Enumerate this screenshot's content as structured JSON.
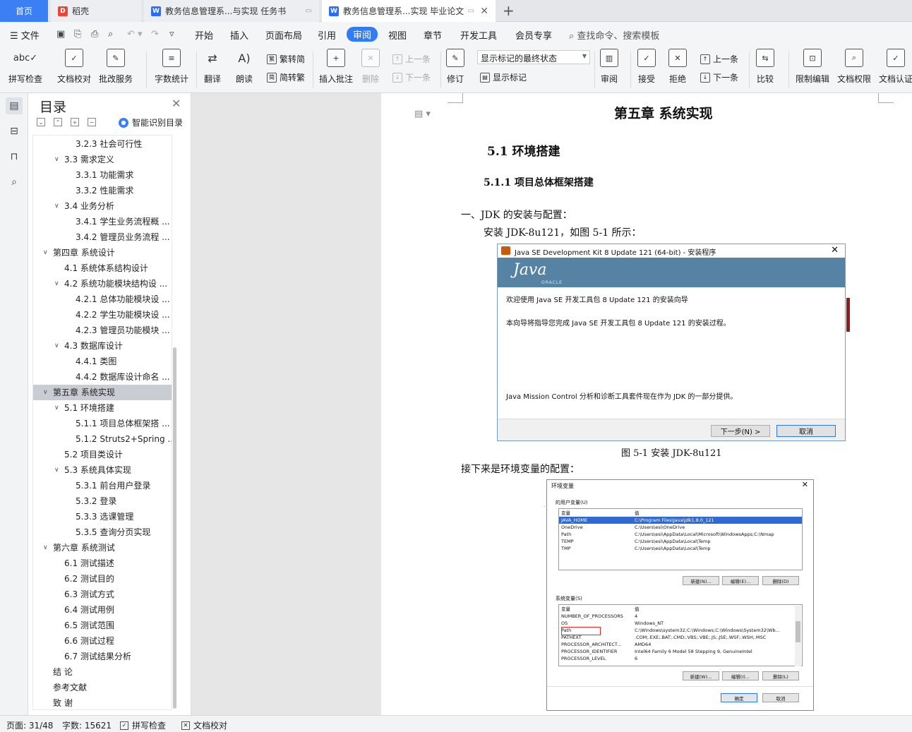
{
  "tabs": {
    "home": "首页",
    "docer": "稻壳",
    "doc1": "教务信息管理系...与实现 任务书",
    "doc2": "教务信息管理系...实现 毕业论文"
  },
  "menu": {
    "file": "文件",
    "items": [
      "开始",
      "插入",
      "页面布局",
      "引用",
      "审阅",
      "视图",
      "章节",
      "开发工具",
      "会员专享"
    ],
    "search": "查找命令、搜索模板"
  },
  "ribbon": {
    "spell": "拼写检查",
    "proof": "文档校对",
    "batch": "批改服务",
    "wordcount": "字数统计",
    "translate": "翻译",
    "read": "朗读",
    "t2s": "繁转简",
    "s2t": "简转繁",
    "insert_comment": "插入批注",
    "delete": "删除",
    "prev_comment": "上一条",
    "next_comment": "下一条",
    "track": "修订",
    "markup_state": "显示标记的最终状态",
    "show_markup": "显示标记",
    "review": "审阅",
    "accept": "接受",
    "reject": "拒绝",
    "prev_change": "上一条",
    "next_change": "下一条",
    "compare": "比较",
    "restrict": "限制编辑",
    "permission": "文档权限",
    "certify": "文档认证"
  },
  "toc": {
    "title": "目录",
    "smart": "智能识别目录",
    "items": [
      {
        "text": "3.2.3  社会可行性",
        "level": 3,
        "arrow": ""
      },
      {
        "text": "3.3  需求定义",
        "level": 2,
        "arrow": "v"
      },
      {
        "text": "3.3.1  功能需求",
        "level": 3,
        "arrow": ""
      },
      {
        "text": "3.3.2  性能需求",
        "level": 3,
        "arrow": ""
      },
      {
        "text": "3.4  业务分析",
        "level": 2,
        "arrow": "v"
      },
      {
        "text": "3.4.1  学生业务流程概 ...",
        "level": 3,
        "arrow": ""
      },
      {
        "text": "3.4.2  管理员业务流程 ...",
        "level": 3,
        "arrow": ""
      },
      {
        "text": "第四章  系统设计",
        "level": 1,
        "arrow": "v"
      },
      {
        "text": "4.1  系统体系结构设计",
        "level": 2,
        "arrow": ""
      },
      {
        "text": "4.2  系统功能模块结构设 ...",
        "level": 2,
        "arrow": "v"
      },
      {
        "text": "4.2.1  总体功能模块设 ...",
        "level": 3,
        "arrow": ""
      },
      {
        "text": "4.2.2  学生功能模块设 ...",
        "level": 3,
        "arrow": ""
      },
      {
        "text": "4.2.3  管理员功能模块 ...",
        "level": 3,
        "arrow": ""
      },
      {
        "text": "4.3  数据库设计",
        "level": 2,
        "arrow": "v"
      },
      {
        "text": "4.4.1  类图",
        "level": 3,
        "arrow": ""
      },
      {
        "text": "4.4.2  数据库设计命名 ...",
        "level": 3,
        "arrow": ""
      },
      {
        "text": "第五章  系统实现",
        "level": 1,
        "arrow": "v",
        "selected": true
      },
      {
        "text": "5.1  环境搭建",
        "level": 2,
        "arrow": "v"
      },
      {
        "text": "5.1.1  项目总体框架搭 ...",
        "level": 3,
        "arrow": ""
      },
      {
        "text": "5.1.2 Struts2+Spring ...",
        "level": 3,
        "arrow": ""
      },
      {
        "text": "5.2  项目类设计",
        "level": 2,
        "arrow": ""
      },
      {
        "text": "5.3  系统具体实现",
        "level": 2,
        "arrow": "v"
      },
      {
        "text": "5.3.1  前台用户登录",
        "level": 3,
        "arrow": ""
      },
      {
        "text": "5.3.2  登录",
        "level": 3,
        "arrow": ""
      },
      {
        "text": "5.3.3  选课管理",
        "level": 3,
        "arrow": ""
      },
      {
        "text": "5.3.5  查询分页实现",
        "level": 3,
        "arrow": ""
      },
      {
        "text": "第六章  系统测试",
        "level": 1,
        "arrow": "v"
      },
      {
        "text": "6.1  测试描述",
        "level": 2,
        "arrow": ""
      },
      {
        "text": "6.2  测试目的",
        "level": 2,
        "arrow": ""
      },
      {
        "text": "6.3  测试方式",
        "level": 2,
        "arrow": ""
      },
      {
        "text": "6.4  测试用例",
        "level": 2,
        "arrow": ""
      },
      {
        "text": "6.5  测试范围",
        "level": 2,
        "arrow": ""
      },
      {
        "text": "6.6  测试过程",
        "level": 2,
        "arrow": ""
      },
      {
        "text": "6.7  测试结果分析",
        "level": 2,
        "arrow": ""
      },
      {
        "text": "结    论",
        "level": 0,
        "arrow": ""
      },
      {
        "text": "参考文献",
        "level": 0,
        "arrow": ""
      },
      {
        "text": "致    谢",
        "level": 0,
        "arrow": ""
      }
    ]
  },
  "doc": {
    "chapter": "第五章  系统实现",
    "section": "5.1  环境搭建",
    "subsection": "5.1.1  项目总体框架搭建",
    "jdk_heading": "一、JDK 的安装与配置：",
    "jdk_install": "安装 JDK-8u121，如图 5-1 所示：",
    "caption1": "图 5-1  安装 JDK-8u121",
    "env_intro": "接下来是环境变量的配置："
  },
  "installer": {
    "title": "Java SE Development Kit 8 Update 121 (64-bit) - 安装程序",
    "logo": "Java",
    "logo_sub": "ORACLE",
    "welcome": "欢迎使用 Java SE 开发工具包 8 Update 121 的安装向导",
    "guide": "本向导将指导您完成 Java SE 开发工具包 8 Update 121 的安装过程。",
    "mission": "Java Mission Control 分析和诊断工具套件现在作为 JDK 的一部分提供。",
    "next": "下一步(N) >",
    "cancel": "取消"
  },
  "envdialog": {
    "title": "环境变量",
    "user_group": "的用户变量(U)",
    "sys_group": "系统变量(S)",
    "col_var": "变量",
    "col_val": "值",
    "user_vars": [
      {
        "name": "JAVA_HOME",
        "value": "C:\\Program Files\\Java\\jdk1.8.0_121",
        "selected": true
      },
      {
        "name": "OneDrive",
        "value": "C:\\Users\\esi\\OneDrive"
      },
      {
        "name": "Path",
        "value": "C:\\Users\\esi\\AppData\\Local\\Microsoft\\WindowsApps;C:\\Nmap"
      },
      {
        "name": "TEMP",
        "value": "C:\\Users\\esi\\AppData\\Local\\Temp"
      },
      {
        "name": "TMP",
        "value": "C:\\Users\\esi\\AppData\\Local\\Temp"
      }
    ],
    "sys_vars": [
      {
        "name": "NUMBER_OF_PROCESSORS",
        "value": "4"
      },
      {
        "name": "OS",
        "value": "Windows_NT"
      },
      {
        "name": "Path",
        "value": "C:\\Windows\\system32;C:\\Windows;C:\\Windows\\System32\\Wb..."
      },
      {
        "name": "PATHEXT",
        "value": ".COM;.EXE;.BAT;.CMD;.VBS;.VBE;.JS;.JSE;.WSF;.WSH;.MSC"
      },
      {
        "name": "PROCESSOR_ARCHITECT...",
        "value": "AMD64"
      },
      {
        "name": "PROCESSOR_IDENTIFIER",
        "value": "Intel64 Family 6 Model 58 Stepping 9, GenuineIntel"
      },
      {
        "name": "PROCESSOR_LEVEL",
        "value": "6"
      }
    ],
    "btn_new": "新建(N)...",
    "btn_edit": "编辑(E)...",
    "btn_delete": "删除(D)",
    "btn_new2": "新建(W)...",
    "btn_edit2": "编辑(I)...",
    "btn_delete2": "删除(L)",
    "ok": "确定",
    "cancel": "取消"
  },
  "status": {
    "page": "页面: 31/48",
    "words": "字数: 15621",
    "spell": "拼写检查",
    "proof": "文档校对"
  }
}
